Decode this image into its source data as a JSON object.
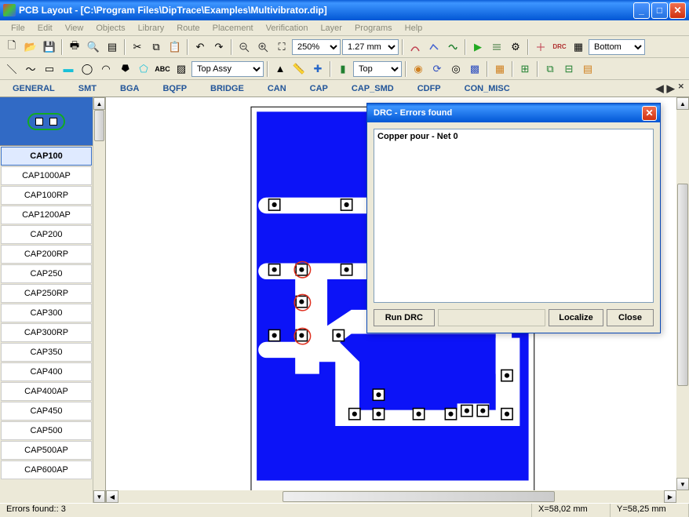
{
  "window": {
    "title": "PCB Layout - [C:\\Program Files\\DipTrace\\Examples\\Multivibrator.dip]"
  },
  "menu": [
    "File",
    "Edit",
    "View",
    "Objects",
    "Library",
    "Route",
    "Placement",
    "Verification",
    "Layer",
    "Programs",
    "Help"
  ],
  "toolbar1": {
    "zoom": "250%",
    "grid": "1.27 mm",
    "layer": "Bottom"
  },
  "toolbar2": {
    "assy": "Top Assy",
    "side": "Top"
  },
  "tabs": [
    "GENERAL",
    "SMT",
    "BGA",
    "BQFP",
    "BRIDGE",
    "CAN",
    "CAP",
    "CAP_SMD",
    "CDFP",
    "CON_MISC"
  ],
  "sidebar": {
    "selected": "CAP100",
    "items": [
      "CAP100",
      "CAP1000AP",
      "CAP100RP",
      "CAP1200AP",
      "CAP200",
      "CAP200RP",
      "CAP250",
      "CAP250RP",
      "CAP300",
      "CAP300RP",
      "CAP350",
      "CAP400",
      "CAP400AP",
      "CAP450",
      "CAP500",
      "CAP500AP",
      "CAP600AP"
    ]
  },
  "dialog": {
    "title": "DRC - Errors found",
    "entries": [
      "Copper pour - Net 0"
    ],
    "run_btn": "Run DRC",
    "localize_btn": "Localize",
    "close_btn": "Close"
  },
  "status": {
    "errors": "Errors found:: 3",
    "x": "X=58,02 mm",
    "y": "Y=58,25 mm"
  }
}
